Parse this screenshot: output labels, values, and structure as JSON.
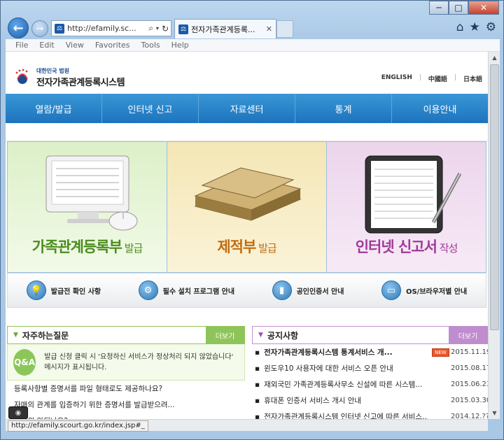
{
  "window": {
    "minimize": "─",
    "maximize": "□",
    "close": "✕"
  },
  "browser": {
    "address": "http://efamily.sc...",
    "tab_title": "전자가족관계등록...",
    "menu": [
      "File",
      "Edit",
      "View",
      "Favorites",
      "Tools",
      "Help"
    ],
    "status_url": "http://efamily.scourt.go.kr/index.jsp#_"
  },
  "site": {
    "logo_top": "대한민국 법원",
    "logo_name": "전자가족관계등록시스템",
    "langs": [
      "ENGLISH",
      "中國語",
      "日本語"
    ]
  },
  "gnb": [
    "열람/발급",
    "인터넷 신고",
    "자료센터",
    "통계",
    "이용안내"
  ],
  "panels": [
    {
      "title": "가족관계등록부",
      "suffix": " 발급"
    },
    {
      "title": "제적부",
      "suffix": " 발급"
    },
    {
      "title": "인터넷 신고서",
      "suffix": " 작성"
    }
  ],
  "quick": [
    {
      "label": "발급전 확인 사항",
      "icon": "lightbulb-icon"
    },
    {
      "label": "필수 설치 프로그램 안내",
      "icon": "gear-icon"
    },
    {
      "label": "공인인증서 안내",
      "icon": "usb-icon"
    },
    {
      "label": "OS/브라우저별 안내",
      "icon": "window-icon"
    }
  ],
  "faq": {
    "title": "자주하는질문",
    "more": "더보기",
    "badge": "Q&A",
    "lead": "발급 신청 클릭 시 '요청하신 서비스가 정상처리 되지 않았습니다' 메시지가 표시됩니다.",
    "items": [
      "등록사항별 증명서를 파일 형태로도 제공하나요?",
      "자매의 관계를 입증하기 위한 증명서를 발급받으려...",
      "...제외 안되나요?"
    ]
  },
  "notice": {
    "title": "공지사항",
    "more": "더보기",
    "new_label": "NEW",
    "items": [
      {
        "title": "전자가족관계등록시스템 통계서비스 개...",
        "date": "2015.11.19",
        "new": true
      },
      {
        "title": "윈도우10 사용자에 대한 서비스 오픈 안내",
        "date": "2015.08.17",
        "new": false
      },
      {
        "title": "재외국민 가족관계등록사무소 신설에 따른 시스템...",
        "date": "2015.06.23",
        "new": false
      },
      {
        "title": "휴대폰 인증서 서비스 개시 안내",
        "date": "2015.03.30",
        "new": false
      },
      {
        "title": "전자가족관계등록시스템 인터넷 신고에 따른 서비스...",
        "date": "2014.12.??",
        "new": false
      }
    ]
  },
  "colors": {
    "nav": "#1d73bd",
    "faq_accent": "#8fc45a",
    "notice_accent": "#bf8ccd"
  }
}
